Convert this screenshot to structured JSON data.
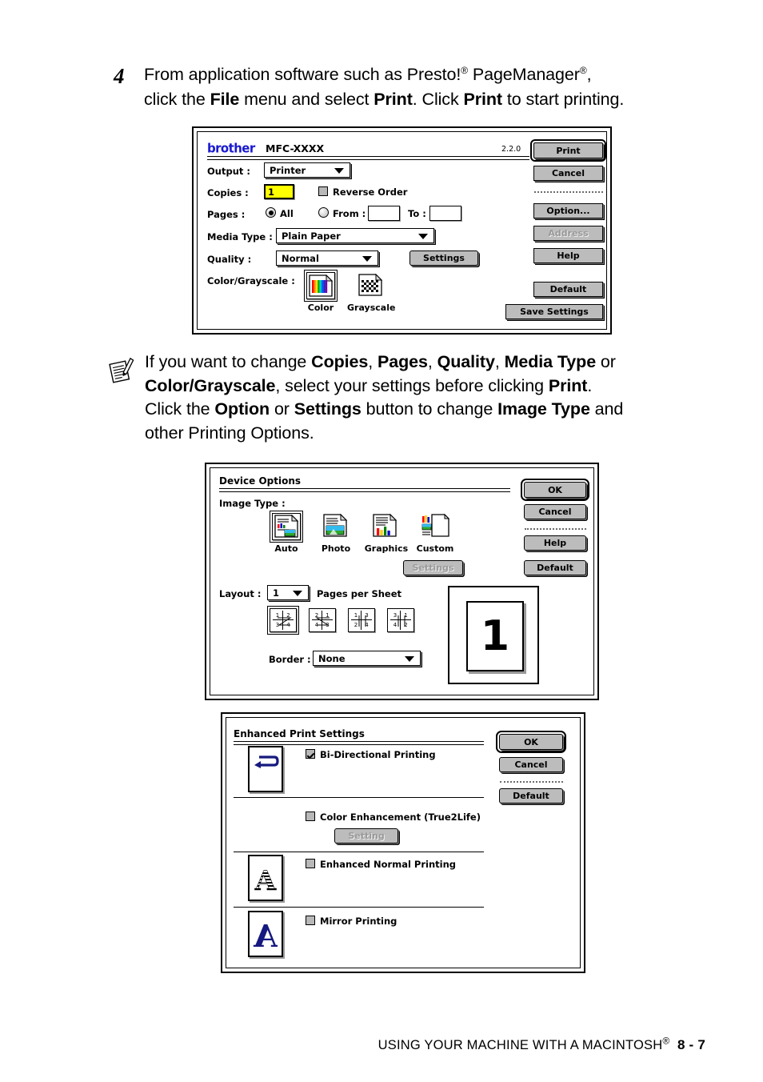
{
  "step": {
    "number": "4",
    "line1_pre": "From application software such as Presto!",
    "line1_mid": " PageManager",
    "line1_end": ",",
    "line2_pre": "click the ",
    "line2_file": "File",
    "line2_mid": " menu and select ",
    "line2_print1": "Print",
    "line2_mid2": ". Click ",
    "line2_print2": "Print",
    "line2_end": " to start printing."
  },
  "print_dialog": {
    "brand": "brother",
    "model": "MFC-XXXX",
    "version": "2.2.0",
    "fields": {
      "output_label": "Output :",
      "output_value": "Printer",
      "copies_label": "Copies :",
      "copies_value": "1",
      "reverse_order_label": "Reverse Order",
      "reverse_order_checked": false,
      "pages_label": "Pages :",
      "pages_all_label": "All",
      "pages_all_selected": true,
      "pages_from_label": "From :",
      "pages_from_value": "",
      "pages_to_label": "To :",
      "pages_to_value": "",
      "media_type_label": "Media Type :",
      "media_type_value": "Plain Paper",
      "quality_label": "Quality :",
      "quality_value": "Normal",
      "quality_settings_button": "Settings",
      "color_grayscale_label": "Color/Grayscale :",
      "color_caption": "Color",
      "grayscale_caption": "Grayscale"
    },
    "buttons": {
      "print": "Print",
      "cancel": "Cancel",
      "option": "Option...",
      "address": "Address",
      "help": "Help",
      "default": "Default",
      "save_settings": "Save Settings"
    }
  },
  "note": {
    "l1_a": "If you want to change ",
    "l1_copies": "Copies",
    "l1_b": ", ",
    "l1_pages": "Pages",
    "l1_c": ", ",
    "l1_quality": "Quality",
    "l1_d": ", ",
    "l1_media": "Media Type",
    "l1_e": " or",
    "l2_cg": "Color/Grayscale",
    "l2_a": ", select your settings before clicking ",
    "l2_print": "Print",
    "l2_b": ".",
    "l3_a": "Click the ",
    "l3_option": "Option",
    "l3_b": " or ",
    "l3_settings": "Settings",
    "l3_c": " button to change ",
    "l3_imagetype": "Image Type",
    "l3_d": " and",
    "l4": "other Printing Options."
  },
  "device_options": {
    "title": "Device Options",
    "image_type_label": "Image Type :",
    "image_types": [
      {
        "caption": "Auto",
        "selected": true
      },
      {
        "caption": "Photo",
        "selected": false
      },
      {
        "caption": "Graphics",
        "selected": false
      },
      {
        "caption": "Custom",
        "selected": false
      }
    ],
    "settings_button": "Settings",
    "settings_disabled": true,
    "layout_label": "Layout :",
    "layout_value": "1",
    "pages_per_sheet_label": "Pages per Sheet",
    "page_orders": [
      {
        "cells": [
          "1",
          "2",
          "3",
          "4"
        ],
        "selected": true
      },
      {
        "cells": [
          "2",
          "1",
          "4",
          "3"
        ],
        "selected": false
      },
      {
        "cells": [
          "1",
          "3",
          "2",
          "4"
        ],
        "selected": false
      },
      {
        "cells": [
          "3",
          "1",
          "4",
          "2"
        ],
        "selected": false
      }
    ],
    "border_label": "Border :",
    "border_value": "None",
    "preview_number": "1",
    "buttons": {
      "ok": "OK",
      "cancel": "Cancel",
      "help": "Help",
      "default": "Default"
    }
  },
  "enhanced_print": {
    "title": "Enhanced Print Settings",
    "options": [
      {
        "label": "Bi-Directional Printing",
        "checked": true
      },
      {
        "label": "Color Enhancement (True2Life)",
        "checked": false
      },
      {
        "label": "Enhanced Normal Printing",
        "checked": false
      },
      {
        "label": "Mirror Printing",
        "checked": false
      }
    ],
    "setting_button": "Setting",
    "setting_disabled": true,
    "buttons": {
      "ok": "OK",
      "cancel": "Cancel",
      "default": "Default"
    }
  },
  "footer": {
    "text": "USING YOUR MACHINE WITH A MACINTOSH",
    "page": "8 - 7"
  }
}
